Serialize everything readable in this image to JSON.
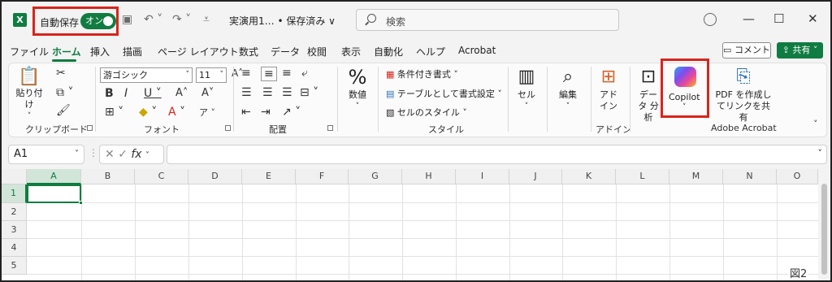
{
  "titlebar": {
    "app_icon": "X",
    "autosave_label": "自動保存",
    "autosave_state": "オン",
    "doc_title": "実演用1… • 保存済み ∨",
    "search_placeholder": "検索",
    "save_icon": "save-icon",
    "undo_icon": "undo-icon",
    "redo_icon": "redo-icon"
  },
  "tabs": [
    "ファイル",
    "ホーム",
    "挿入",
    "描画",
    "ページ レイアウト",
    "数式",
    "データ",
    "校閲",
    "表示",
    "自動化",
    "ヘルプ",
    "Acrobat"
  ],
  "active_tab": "ホーム",
  "actions": {
    "comment": "コメント",
    "share": "共有"
  },
  "ribbon": {
    "clipboard": {
      "paste": "貼り付け",
      "label": "クリップボード"
    },
    "font": {
      "name": "游ゴシック",
      "size": "11",
      "label": "フォント"
    },
    "alignment": {
      "label": "配置"
    },
    "number": {
      "label": "数値"
    },
    "styles": {
      "conditional": "条件付き書式",
      "table": "テーブルとして書式設定",
      "cell_style": "セルのスタイル",
      "label": "スタイル"
    },
    "cells": {
      "label": "セル"
    },
    "editing": {
      "label": "編集"
    },
    "addins": {
      "button": "アド イン",
      "label": "アドイン"
    },
    "analyze": {
      "button": "データ 分析"
    },
    "copilot": {
      "button": "Copilot"
    },
    "acrobat": {
      "button_line1": "PDF を作成し",
      "button_line2": "てリンクを共有",
      "label": "Adobe Acrobat"
    }
  },
  "formula_bar": {
    "name_box": "A1",
    "fx": "fx",
    "value": ""
  },
  "grid": {
    "columns": [
      "A",
      "B",
      "C",
      "D",
      "E",
      "F",
      "G",
      "H",
      "I",
      "J",
      "K",
      "L",
      "M",
      "N",
      "O"
    ],
    "rows": [
      "1",
      "2",
      "3",
      "4",
      "5"
    ],
    "selected_cell": "A1"
  },
  "figure_label": "図2",
  "colors": {
    "accent": "#107c41",
    "highlight_box": "#d9241b"
  }
}
